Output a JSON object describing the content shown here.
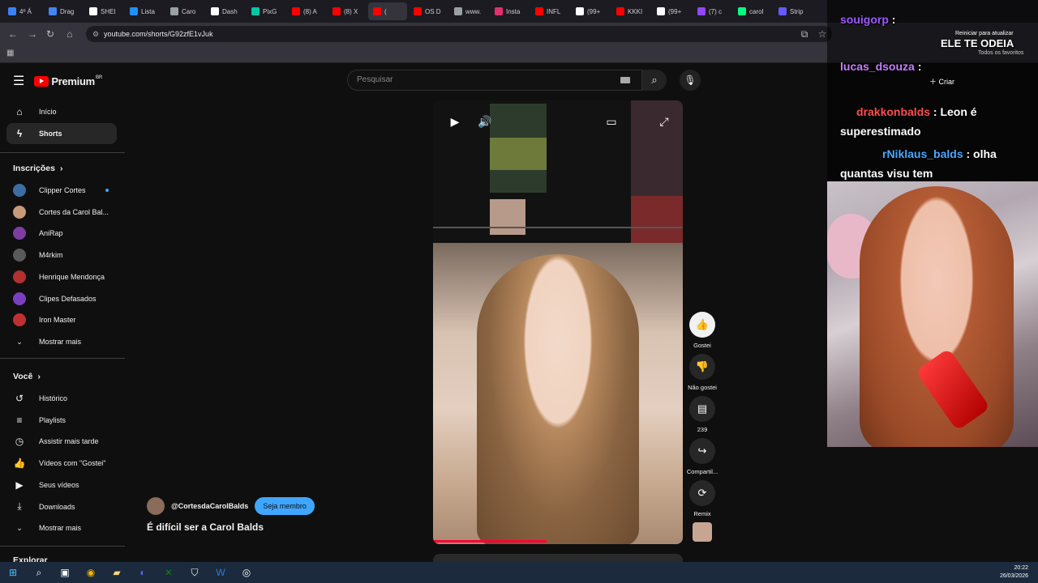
{
  "browser": {
    "tabs": [
      {
        "label": "4º Á",
        "color": "#3b82f6"
      },
      {
        "label": "Drag",
        "color": "#4285f4"
      },
      {
        "label": "SHEI",
        "color": "#ffffff"
      },
      {
        "label": "Lista",
        "color": "#1e90ff"
      },
      {
        "label": "Caro",
        "color": "#9aa0a6"
      },
      {
        "label": "Dash",
        "color": "#ffffff"
      },
      {
        "label": "PixG",
        "color": "#00c9a7"
      },
      {
        "label": "(8) A",
        "color": "#ff0000"
      },
      {
        "label": "(8) X",
        "color": "#ff0000"
      },
      {
        "label": "(",
        "color": "#ff0000"
      },
      {
        "label": "OS D",
        "color": "#ff0000"
      },
      {
        "label": "www.",
        "color": "#9aa0a6"
      },
      {
        "label": "Insta",
        "color": "#e1306c"
      },
      {
        "label": "INFL",
        "color": "#ff0000"
      },
      {
        "label": "(99+",
        "color": "#ffffff"
      },
      {
        "label": "KKKI",
        "color": "#ff0000"
      },
      {
        "label": "(99+",
        "color": "#ffffff"
      },
      {
        "label": "(7) c",
        "color": "#9146ff"
      },
      {
        "label": "carol",
        "color": "#00ff7f"
      },
      {
        "label": "Strip",
        "color": "#635bff"
      }
    ],
    "url": "youtube.com/shorts/G92zfE1vJuk"
  },
  "youtube": {
    "brand": "Premium",
    "region": "BR",
    "search_placeholder": "Pesquisar",
    "nav": [
      {
        "label": "Início",
        "icon": "home-icon"
      },
      {
        "label": "Shorts",
        "icon": "shorts-icon"
      }
    ],
    "subscriptions_title": "Inscrições",
    "subscriptions": [
      {
        "label": "Clipper Cortes",
        "color": "#3a6ea5"
      },
      {
        "label": "Cortes da Carol Bal...",
        "color": "#c89a7a"
      },
      {
        "label": "AniRap",
        "color": "#7b3fa0"
      },
      {
        "label": "M4rkim",
        "color": "#5a5a5a"
      },
      {
        "label": "Henrique Mendonça",
        "color": "#b23030"
      },
      {
        "label": "Clipes Defasados",
        "color": "#7a3fc0"
      },
      {
        "label": "Iron Master",
        "color": "#c03030"
      }
    ],
    "show_more": "Mostrar mais",
    "you_title": "Você",
    "you_items": [
      {
        "label": "Histórico",
        "icon": "history-icon"
      },
      {
        "label": "Playlists",
        "icon": "playlists-icon"
      },
      {
        "label": "Assistir mais tarde",
        "icon": "watch-later-icon"
      },
      {
        "label": "Vídeos com \"Gostei\"",
        "icon": "liked-icon"
      },
      {
        "label": "Seus vídeos",
        "icon": "your-videos-icon"
      },
      {
        "label": "Downloads",
        "icon": "download-icon"
      }
    ],
    "show_more_2": "Mostrar mais",
    "explore_title": "Explorar",
    "channel_handle": "@CortesdaCarolBalds",
    "join_label": "Seja membro",
    "video_title": "É difícil ser a Carol Balds",
    "actions": {
      "like": "Gostei",
      "dislike": "Não gostei",
      "comments": "239",
      "share": "Compartil...",
      "remix": "Remix"
    }
  },
  "stream_overlay": {
    "chat": [
      {
        "user": "souigorp",
        "text": ":",
        "color": "#9b59ff"
      },
      {
        "user": "",
        "text": "ELE TE ODEIA",
        "color": "#ffffff"
      },
      {
        "user": "lucas_dsouza",
        "text": ":",
        "color": "#c77dff"
      },
      {
        "user": "drakkonbalds",
        "text": ": Leon é superestimado",
        "color": "#ff4d4d"
      },
      {
        "user": "rNiklaus_balds",
        "text": ": olha quantas visu tem",
        "color": "#4da6ff"
      }
    ],
    "restart_label": "Reiniciar para atualizar",
    "favorites_label": "Todos os favoritos",
    "create_label": "Criar"
  },
  "taskbar": {
    "time": "20:22",
    "date": "26/03/2026"
  }
}
